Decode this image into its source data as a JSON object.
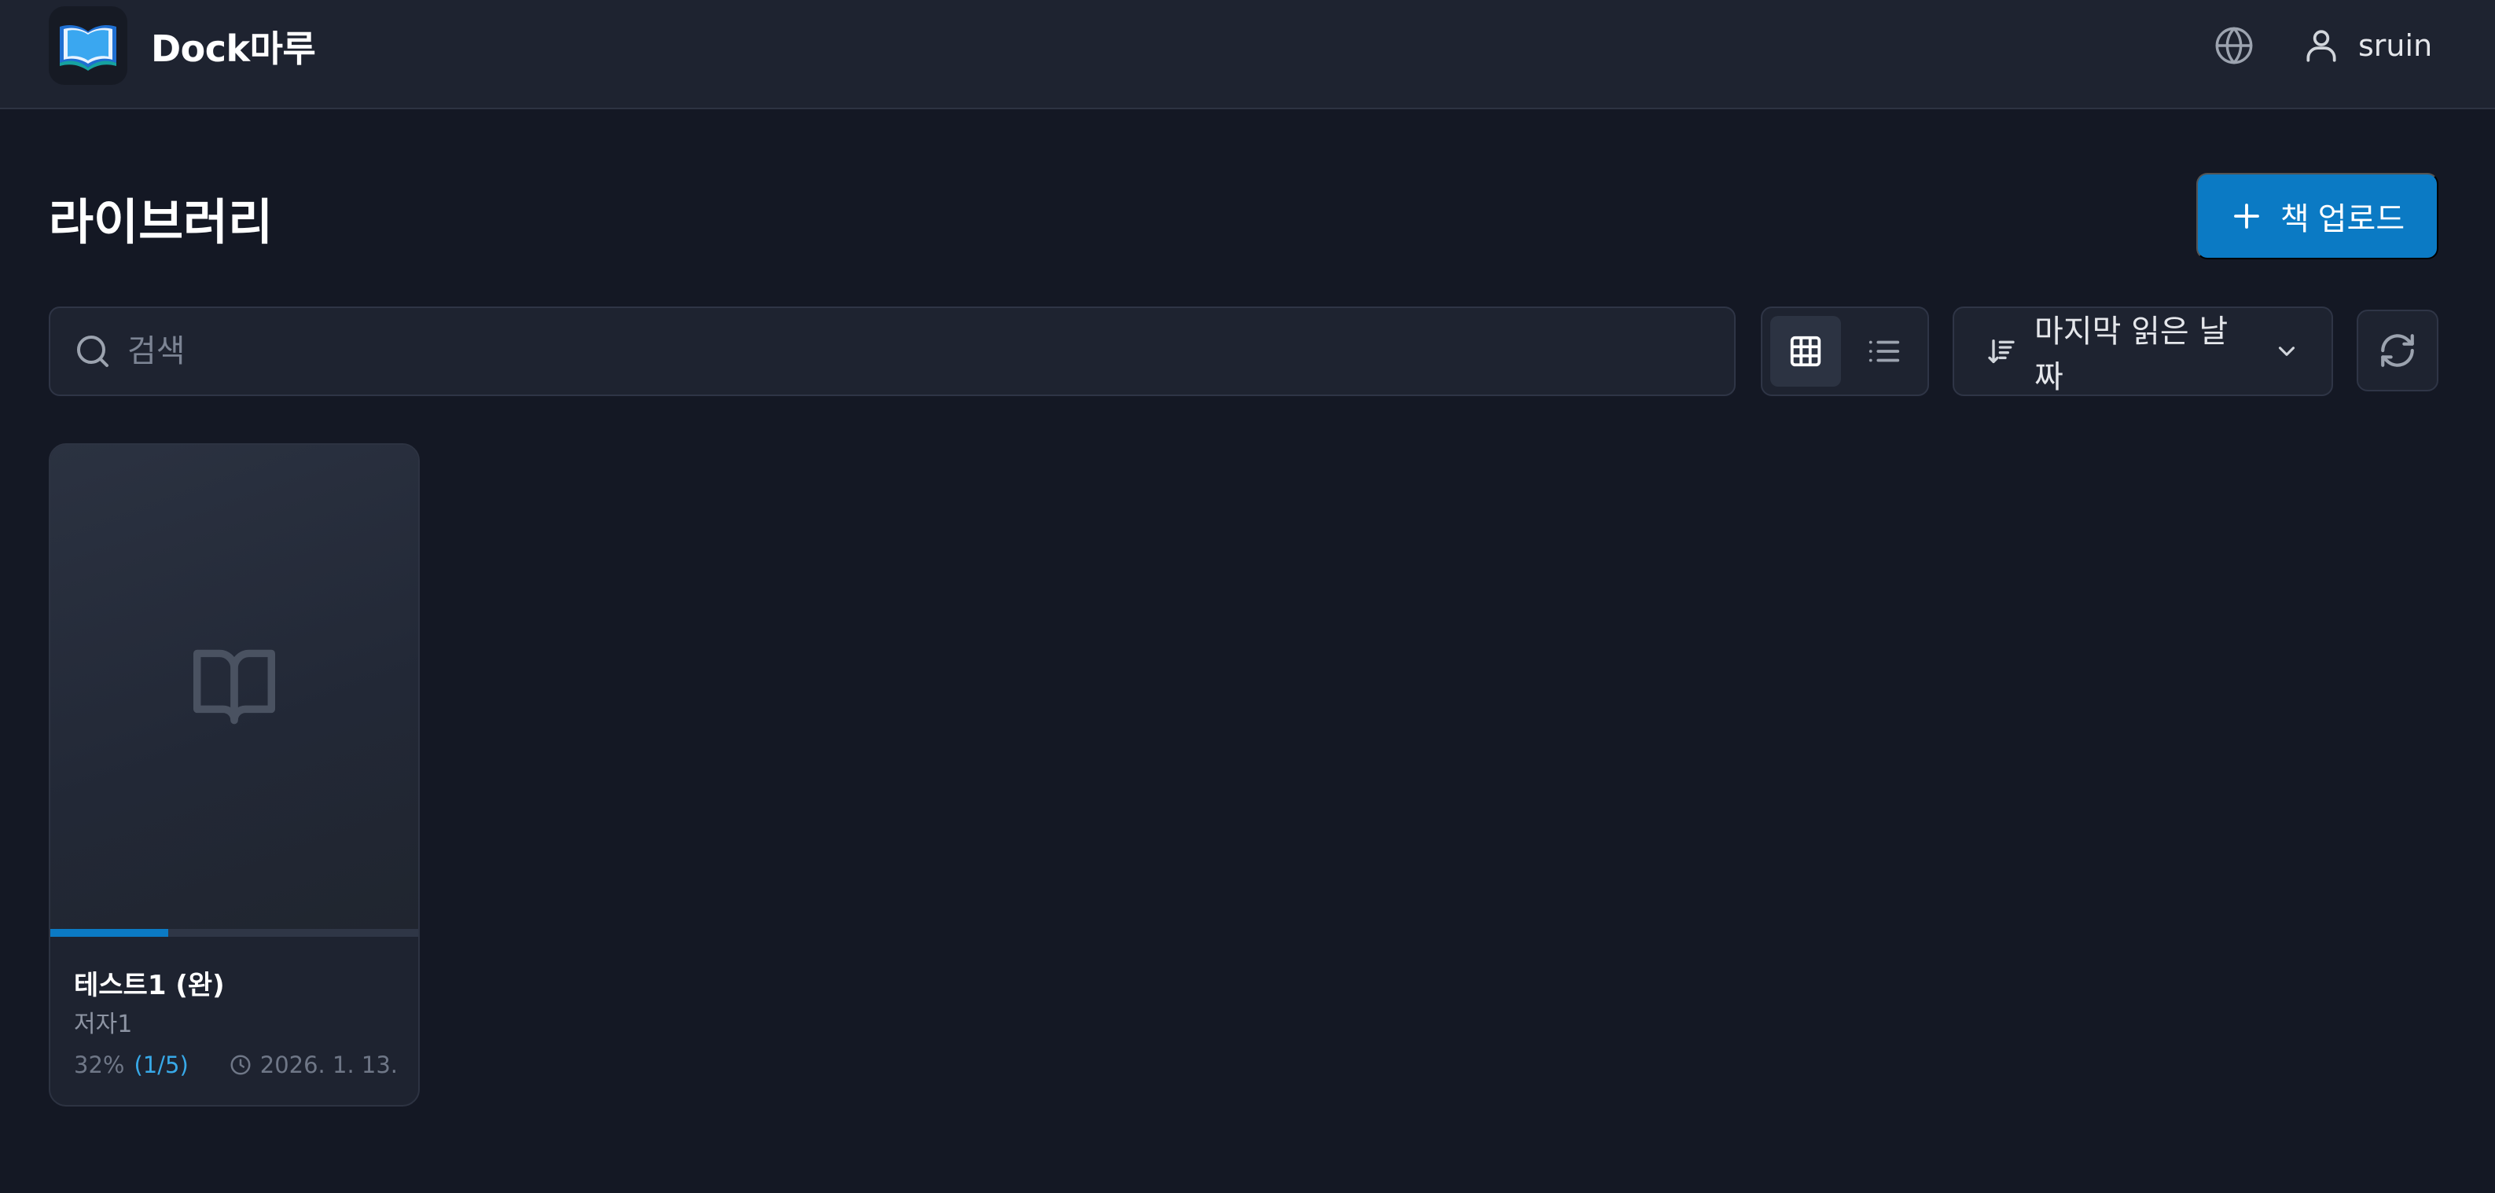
{
  "header": {
    "app_name": "Dock마루",
    "username": "sruin",
    "icons": {
      "logo": "open-book-logo",
      "language": "globe-icon",
      "user": "user-icon"
    }
  },
  "library": {
    "title": "라이브러리",
    "upload_label": "책 업로드",
    "search_placeholder": "검색",
    "search_value": "",
    "view_modes": [
      "grid",
      "list"
    ],
    "active_view": "grid",
    "sort_label": "마지막 읽은 날짜",
    "refresh_icon": "refresh-icon"
  },
  "books": [
    {
      "title": "테스트1 (완)",
      "author": "저자1",
      "progress_percent": "32%",
      "progress_fraction": 0.32,
      "pages": "(1/5)",
      "last_read": "2026. 1. 13."
    }
  ],
  "colors": {
    "accent": "#0b7ac4",
    "pages_link": "#38a9e8",
    "background": "#141824",
    "surface": "#1e2330"
  }
}
